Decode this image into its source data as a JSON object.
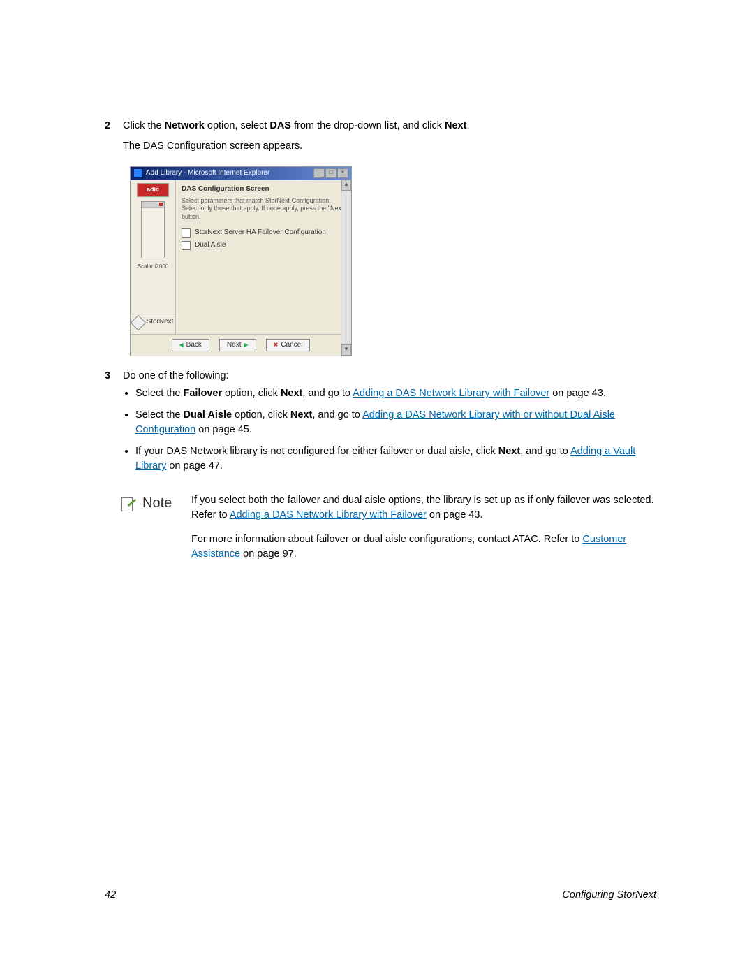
{
  "step2": {
    "num": "2",
    "text_pre": "Click the ",
    "bold1": "Network",
    "text_mid1": " option, select ",
    "bold2": "DAS",
    "text_mid2": " from the drop-down list, and click ",
    "bold3": "Next",
    "text_end": ".",
    "line2": "The DAS Configuration screen appears."
  },
  "dialog": {
    "title": "Add Library - Microsoft Internet Explorer",
    "adic": "adic",
    "rack_label": "Scalar i2000",
    "stornext": "StorNext",
    "heading": "DAS Configuration Screen",
    "desc": "Select parameters that match StorNext Configuration. Select only those that apply. If none apply, press the \"Next\" button.",
    "check1": "StorNext Server HA Failover Configuration",
    "check2": "Dual Aisle",
    "back": "Back",
    "next": "Next",
    "cancel": "Cancel"
  },
  "step3": {
    "num": "3",
    "intro": "Do one of the following:",
    "b1_pre": "Select the ",
    "b1_bold1": "Failover",
    "b1_mid1": " option, click ",
    "b1_bold2": "Next",
    "b1_mid2": ", and go to ",
    "b1_link": "Adding a DAS Network Library with Failover",
    "b1_end": " on page 43.",
    "b2_pre": "Select the ",
    "b2_bold1": "Dual Aisle",
    "b2_mid1": " option, click ",
    "b2_bold2": "Next",
    "b2_mid2": ", and go to ",
    "b2_link": "Adding a DAS Network Library with or without Dual Aisle Configuration",
    "b2_end": " on page 45.",
    "b3_pre": "If your DAS Network library is not configured for either failover or dual aisle, click ",
    "b3_bold1": "Next",
    "b3_mid1": ", and go to ",
    "b3_link": "Adding a Vault Library",
    "b3_end": " on page 47."
  },
  "note": {
    "label": "Note",
    "p1_pre": "If you select both the failover and dual aisle options, the library is set up as if only failover was selected. Refer to ",
    "p1_link": "Adding a DAS Network Library with Failover",
    "p1_end": " on page 43.",
    "p2_pre": "For more information about failover or dual aisle configurations, contact ATAC. Refer to ",
    "p2_link": "Customer Assistance",
    "p2_end": " on page 97."
  },
  "footer": {
    "page": "42",
    "section": "Configuring StorNext"
  }
}
